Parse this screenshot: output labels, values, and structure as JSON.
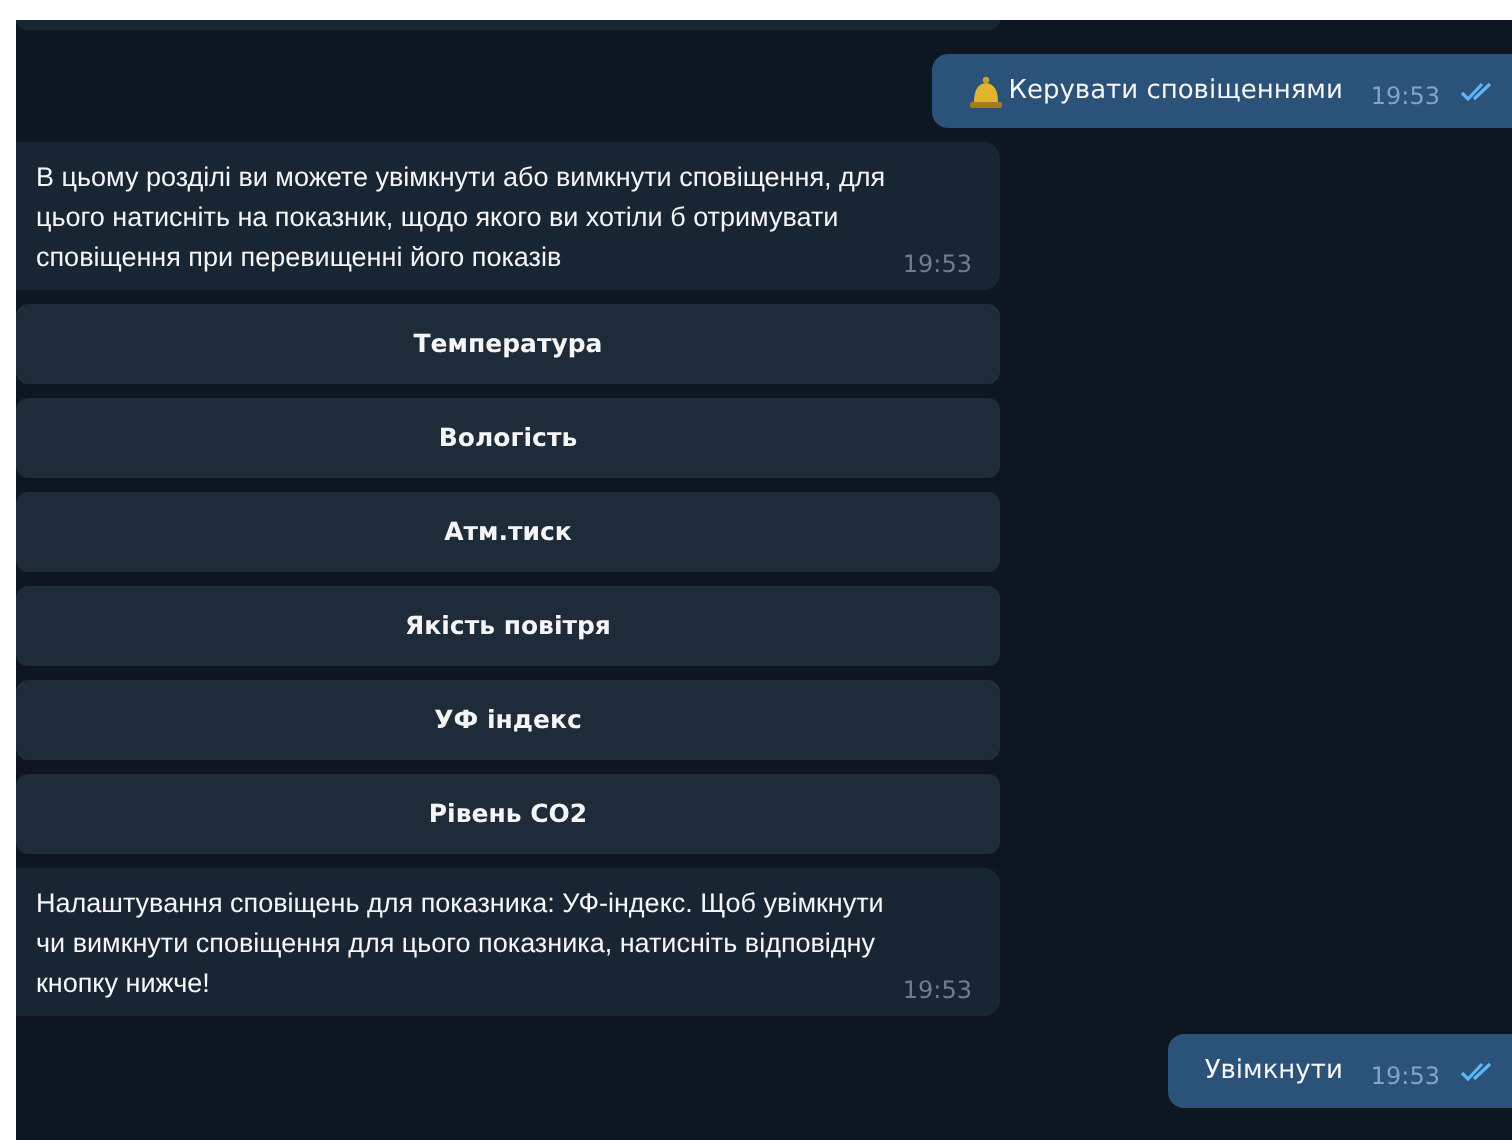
{
  "messages": [
    {
      "kind": "out_bell",
      "text": "Керувати сповіщеннями",
      "time": "19:53",
      "read": true
    },
    {
      "kind": "in",
      "text": "В цьому розділі ви можете увімкнути або вимкнути сповіщення, для цього натисніть на показник, щодо якого ви хотіли б отримувати сповіщення при перевищенні його показів",
      "time": "19:53"
    },
    {
      "kind": "buttons",
      "buttons": [
        "Температура",
        "Вологість",
        "Атм.тиск",
        "Якість повітря",
        "УФ індекс",
        "Рівень CO2"
      ]
    },
    {
      "kind": "in",
      "text": "Налаштування сповіщень для показника: УФ-індекс. Щоб увімкнути чи вимкнути сповіщення для цього показника, натисніть відповідну кнопку нижче!",
      "time": "19:53"
    },
    {
      "kind": "out",
      "text": "Увімкнути",
      "time": "19:53",
      "read": true
    }
  ]
}
